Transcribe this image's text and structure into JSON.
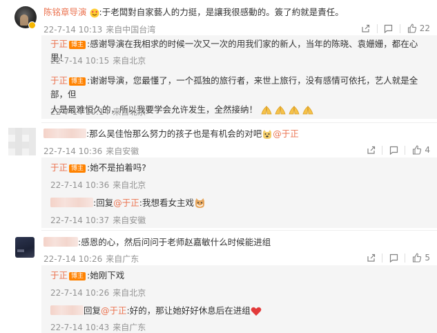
{
  "comments": [
    {
      "author": "陈铭章导演",
      "text": ":于老闆對自家藝人的力挺，是讓我很感動的。簽了約就是責任。",
      "time": "22-7-14 10:13",
      "location": "来自中国台湾",
      "likes": "22",
      "replies": [
        {
          "author": "于正",
          "badge": "博主",
          "text": ":感谢导演在我相求的时候一次又一次的用我们家的新人，当年的陈晓、袁姗姗，都在心里！",
          "time": "22-7-14 10:15",
          "location": "来自北京"
        },
        {
          "author": "于正",
          "badge": "博主",
          "text_line1": ":谢谢导演，您最懂了，一个孤独的旅行者，来世上旅行，没有感情可依托，艺人就是全部，但",
          "text_line2": "人是最难恒久的，所以我要学会允许发生，全然接纳！",
          "time": "22-7-14 10:14",
          "location": "来自北京"
        }
      ]
    },
    {
      "author": "",
      "text": ":那么吴佳怡那么努力的孩子也是有机会的对吧",
      "mention": "@于正",
      "time": "22-7-14 10:36",
      "location": "来自安徽",
      "likes": "4",
      "replies": [
        {
          "author": "于正",
          "badge": "博主",
          "text": ":她不是拍着吗?",
          "time": "22-7-14 10:36",
          "location": "来自北京"
        },
        {
          "author": "",
          "prefix": ":回复",
          "mention": "@于正",
          "text": ":我想看女主戏",
          "time": "22-7-14 10:37",
          "location": "来自安徽"
        }
      ]
    },
    {
      "author": "",
      "text": ":感恩的心，然后问问于老师赵嘉敏什么时候能进组",
      "time": "22-7-14 10:26",
      "location": "来自广东",
      "likes": "5",
      "replies": [
        {
          "author": "于正",
          "badge": "博主",
          "text": ":她刚下戏",
          "time": "22-7-14 10:26",
          "location": "来自北京"
        },
        {
          "author": "",
          "prefix": "回复",
          "mention": "@于正",
          "text": ":好的，那让她好好休息后在进组",
          "time": "22-7-14 10:43",
          "location": "来自广东"
        }
      ]
    }
  ],
  "icons": {
    "share": "share-icon",
    "comment": "comment-icon",
    "like": "thumbs-up-icon"
  },
  "colors": {
    "name": "#eb7350",
    "badge": "#ff8200",
    "meta": "#939393",
    "reply_bg": "#f5f5f5"
  }
}
